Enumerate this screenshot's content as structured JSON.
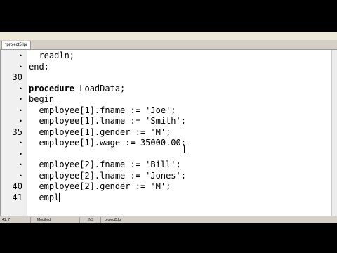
{
  "window": {
    "title": ""
  },
  "tab": {
    "label": "*project5.lpr"
  },
  "editor": {
    "lines": [
      {
        "number": "",
        "text": "  readln;",
        "keyword": false
      },
      {
        "number": "",
        "text": "end;",
        "keyword": true
      },
      {
        "number": "30",
        "text": "",
        "keyword": false
      },
      {
        "number": "",
        "text": "procedure LoadData;",
        "keyword": "procedure"
      },
      {
        "number": "",
        "text": "begin",
        "keyword": true
      },
      {
        "number": "",
        "text": "  employee[1].fname := 'Joe';",
        "keyword": false
      },
      {
        "number": "",
        "text": "  employee[1].lname := 'Smith';",
        "keyword": false
      },
      {
        "number": "35",
        "text": "  employee[1].gender := 'M';",
        "keyword": false
      },
      {
        "number": "",
        "text": "  employee[1].wage := 35000.00;",
        "keyword": false
      },
      {
        "number": "",
        "text": "",
        "keyword": false
      },
      {
        "number": "",
        "text": "  employee[2].fname := 'Bill';",
        "keyword": false
      },
      {
        "number": "",
        "text": "  employee[2].lname := 'Jones';",
        "keyword": false
      },
      {
        "number": "40",
        "text": "  employee[2].gender := 'M';",
        "keyword": false
      },
      {
        "number": "41",
        "text": "  empl",
        "keyword": false,
        "caret": true
      }
    ]
  },
  "status": {
    "position": "41: 7",
    "modified": "Modified",
    "mode": "INS",
    "file": "project5.lpr"
  }
}
